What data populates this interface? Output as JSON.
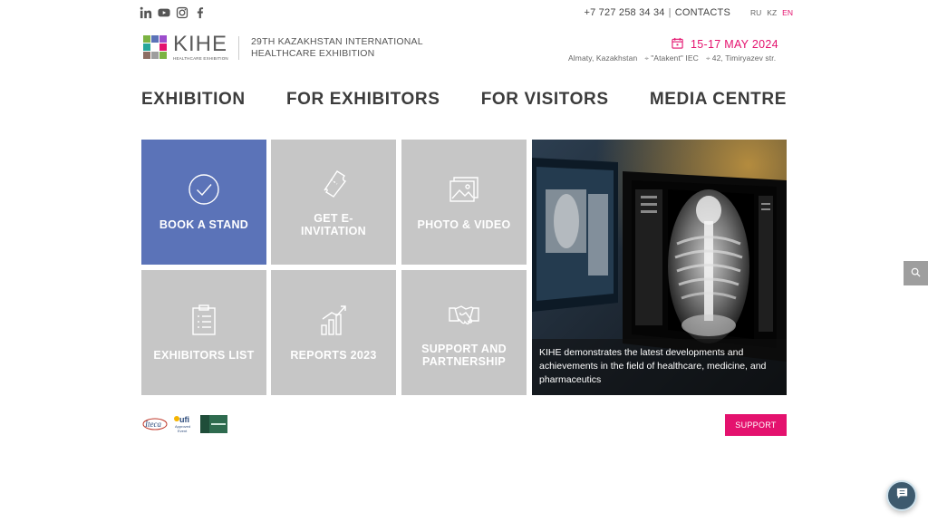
{
  "header": {
    "social": [
      {
        "icon": "linkedin-icon"
      },
      {
        "icon": "youtube-icon"
      },
      {
        "icon": "instagram-icon"
      },
      {
        "icon": "facebook-icon"
      }
    ],
    "phone": "+7 727 258 34 34",
    "separator": "|",
    "contacts_label": "CONTACTS",
    "languages": [
      "RU",
      "KZ",
      "EN"
    ],
    "active_language": "EN",
    "logo_word": "KIHE",
    "logo_subtitle": "HEALTHCARE EXHIBITION",
    "tagline": "29TH KAZAKHSTAN INTERNATIONAL HEALTHCARE EXHIBITION",
    "date": "15-17 MAY 2024",
    "location": {
      "city": "Almaty, Kazakhstan",
      "venue": "\"Atakent\" IEC",
      "address": "42, Timiryazev str."
    }
  },
  "nav": {
    "items": [
      "EXHIBITION",
      "FOR EXHIBITORS",
      "FOR VISITORS",
      "MEDIA CENTRE"
    ]
  },
  "tiles": [
    {
      "label": "BOOK A STAND",
      "icon": "check-circle-icon"
    },
    {
      "label": "GET E-INVITATION",
      "icon": "ticket-icon"
    },
    {
      "label": "PHOTO & VIDEO",
      "icon": "photos-icon"
    },
    {
      "label": "EXHIBITORS LIST",
      "icon": "clipboard-list-icon"
    },
    {
      "label": "REPORTS 2023",
      "icon": "bar-chart-icon"
    },
    {
      "label": "SUPPORT AND PARTNERSHIP",
      "icon": "handshake-icon"
    }
  ],
  "hero": {
    "caption": "KIHE demonstrates the latest developments and achievements in the field of healthcare, medicine, and pharmaceutics"
  },
  "partners": {
    "logos": [
      "Iteca",
      "ufi Approved Event",
      "partner-logo"
    ]
  },
  "support_button": "SUPPORT",
  "colors": {
    "accent": "#e4126e",
    "tile_blue": "#5b73b8",
    "tile_gray": "#c6c6c6"
  }
}
